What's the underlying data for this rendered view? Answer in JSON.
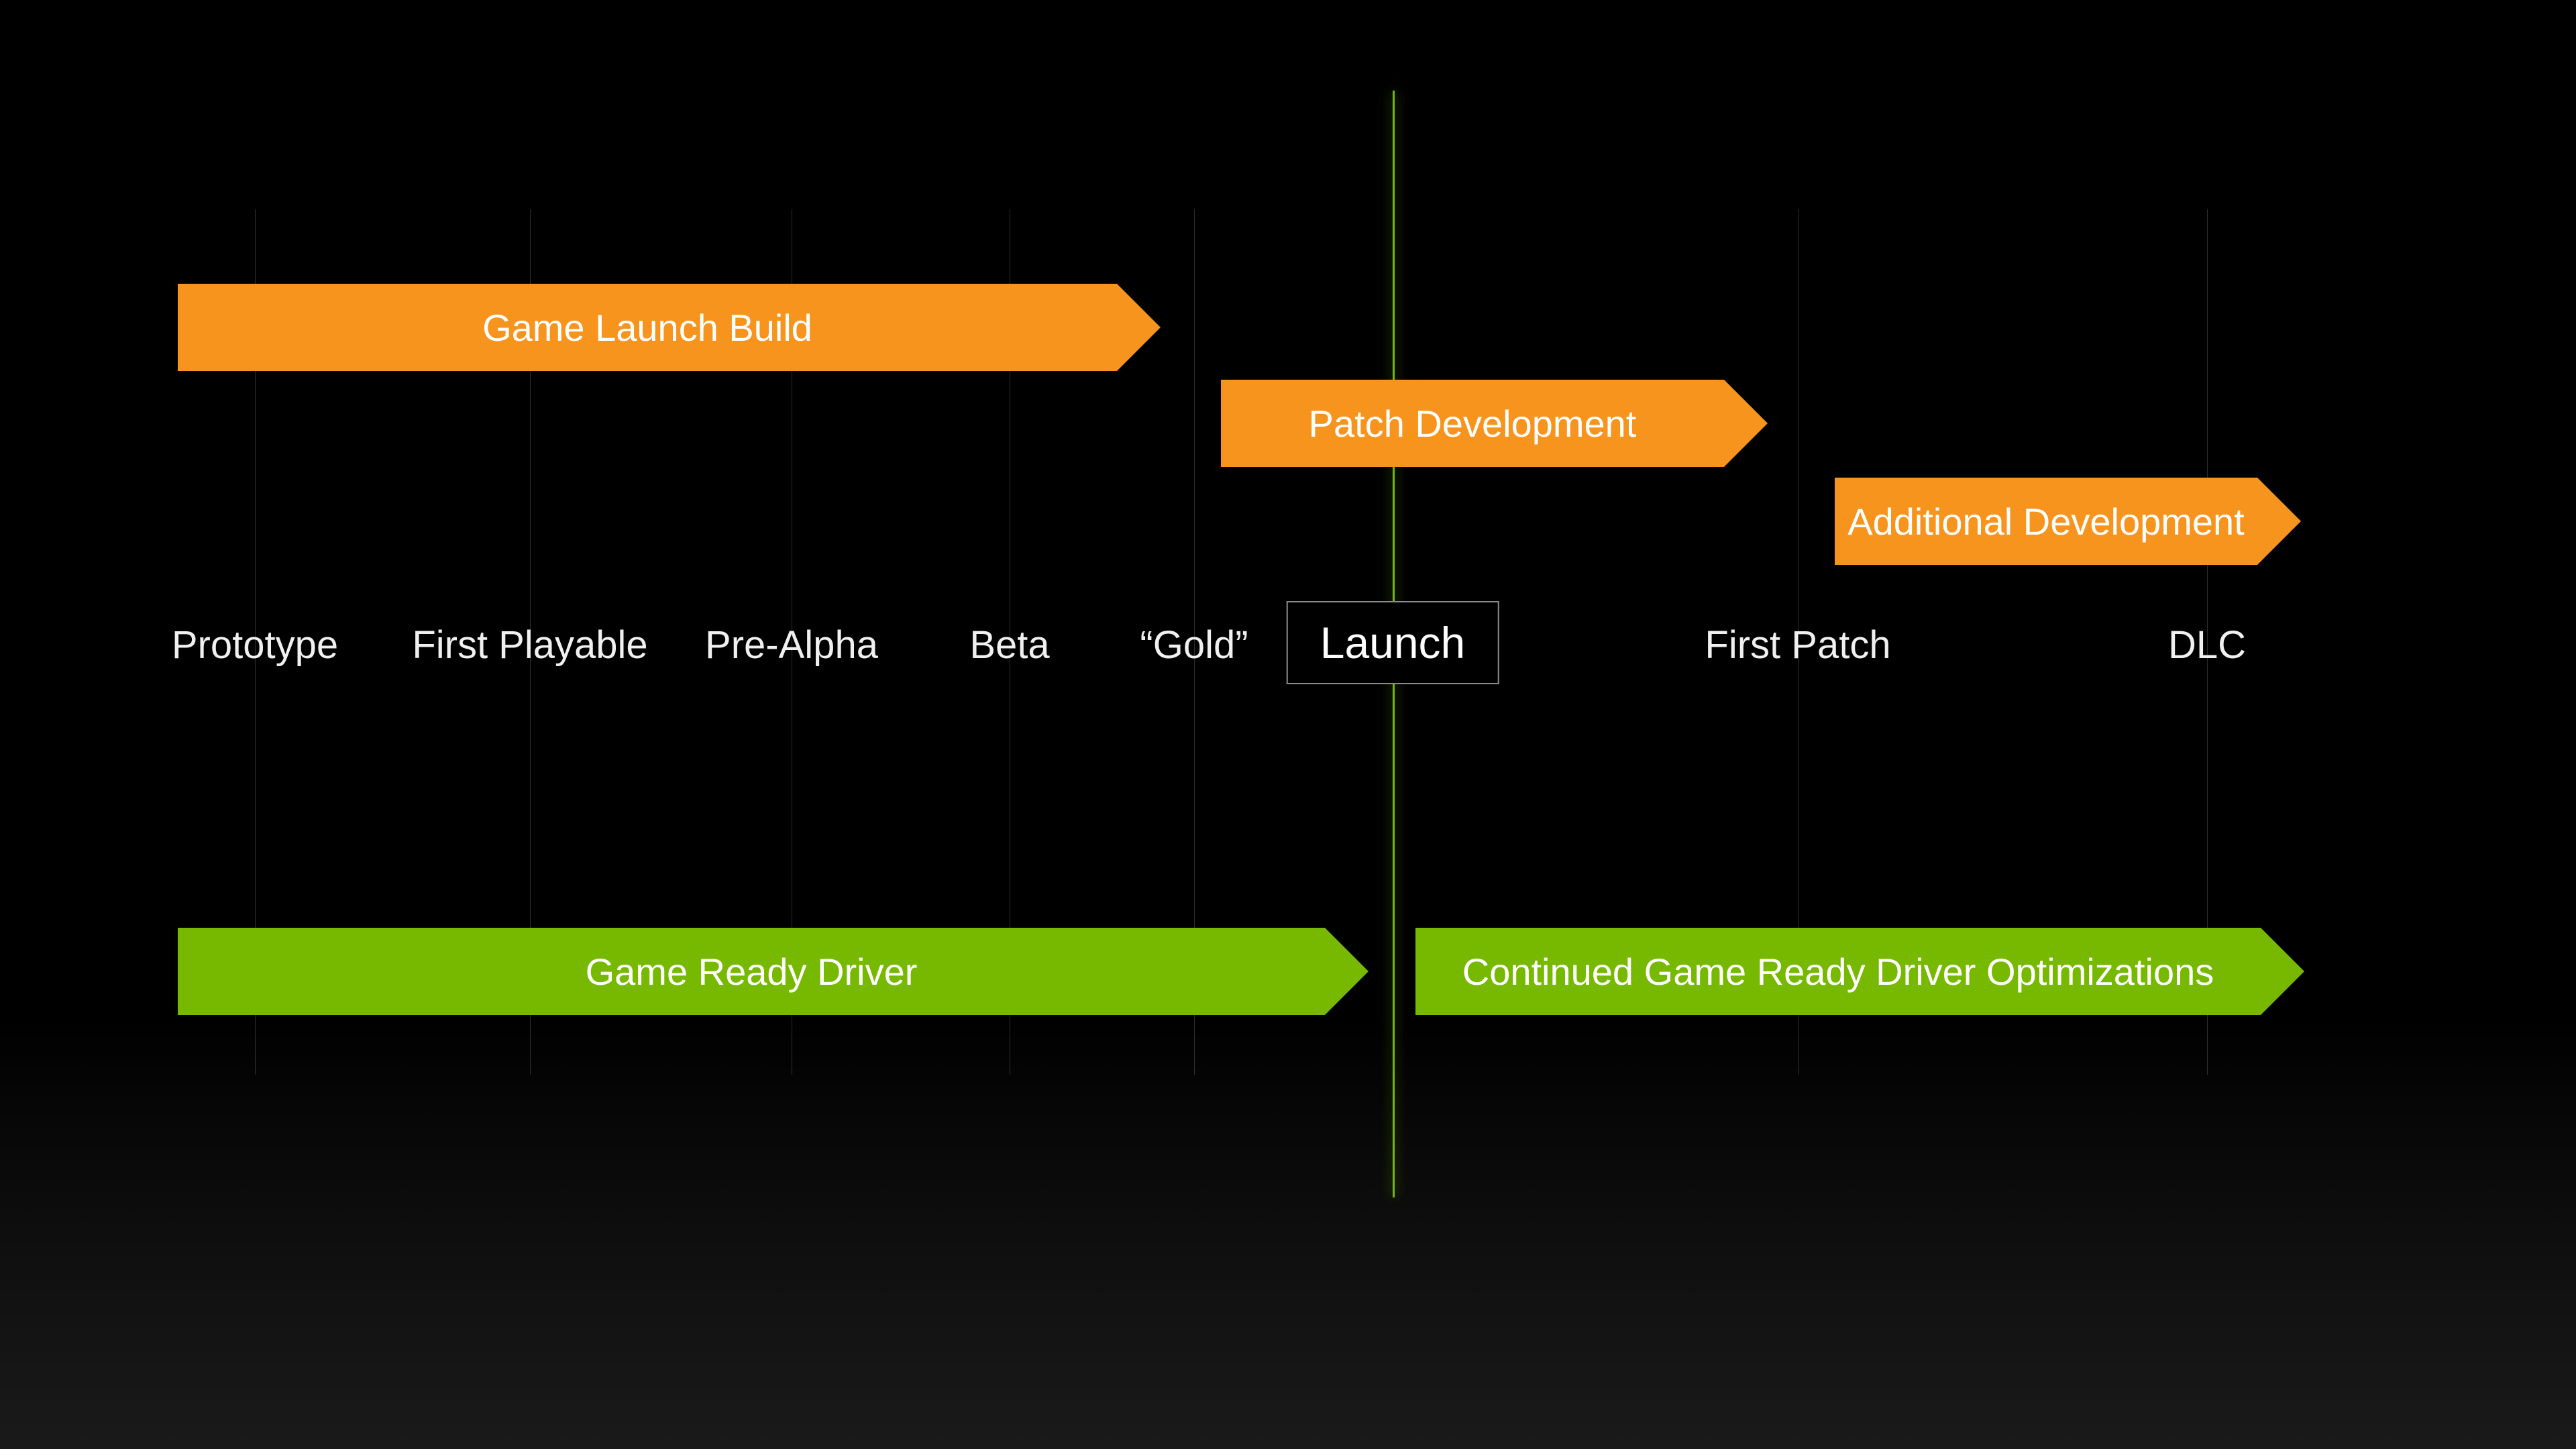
{
  "colors": {
    "orange": "#f7941d",
    "green": "#76b900",
    "grid": "rgba(255,255,255,0.18)"
  },
  "milestones": {
    "prototype": "Prototype",
    "first_playable": "First Playable",
    "pre_alpha": "Pre-Alpha",
    "beta": "Beta",
    "gold": "“Gold”",
    "launch": "Launch",
    "first_patch": "First Patch",
    "dlc": "DLC"
  },
  "bars": {
    "game_launch_build": "Game Launch Build",
    "patch_development": "Patch Development",
    "additional_development": "Additional Development",
    "game_ready_driver": "Game Ready Driver",
    "continued_optimizations": "Continued Game Ready Driver Optimizations"
  }
}
